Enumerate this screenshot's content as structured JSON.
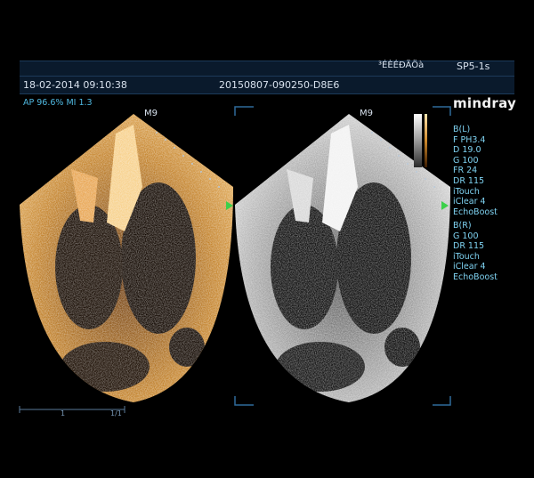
{
  "header": {
    "top_right_code": "³ÉÈÉÐÄÖà",
    "probe": "SP5-1s",
    "datetime": "18-02-2014 09:10:38",
    "study_id": "20150807-090250-D8E6"
  },
  "meta": {
    "ap_mi": "AP 96.6%  MI 1.3",
    "marker": "M9"
  },
  "brand": {
    "name": "mindray"
  },
  "panel_left": {
    "title": "B(L)",
    "params": [
      "F PH3.4",
      "D 19.0",
      "G 100",
      "FR 24",
      "DR 115",
      "iTouch",
      "iClear 4",
      "EchoBoost"
    ]
  },
  "panel_right": {
    "title": "B(R)",
    "params": [
      "G 100",
      "DR 115",
      "iTouch",
      "iClear 4",
      "EchoBoost"
    ]
  },
  "scale": {
    "left_mark": "1",
    "right_mark": "1/1"
  },
  "colors": {
    "accent": "#4fb8e0",
    "header_bg": "#0a1a2c"
  }
}
